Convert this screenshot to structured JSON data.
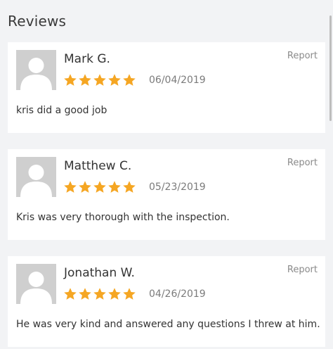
{
  "header": {
    "title": "Reviews"
  },
  "theme": {
    "star_color": "#f5a623",
    "avatar_bg": "#cfcfcf",
    "page_bg": "#f2f3f5"
  },
  "reviews": [
    {
      "name": "Mark G.",
      "rating": 5,
      "date": "06/04/2019",
      "text": "kris did a good job",
      "report_label": "Report"
    },
    {
      "name": "Matthew C.",
      "rating": 5,
      "date": "05/23/2019",
      "text": "Kris was very thorough with the inspection.",
      "report_label": "Report"
    },
    {
      "name": "Jonathan W.",
      "rating": 5,
      "date": "04/26/2019",
      "text": "He was very kind and answered any questions I threw at him.",
      "report_label": "Report"
    }
  ]
}
